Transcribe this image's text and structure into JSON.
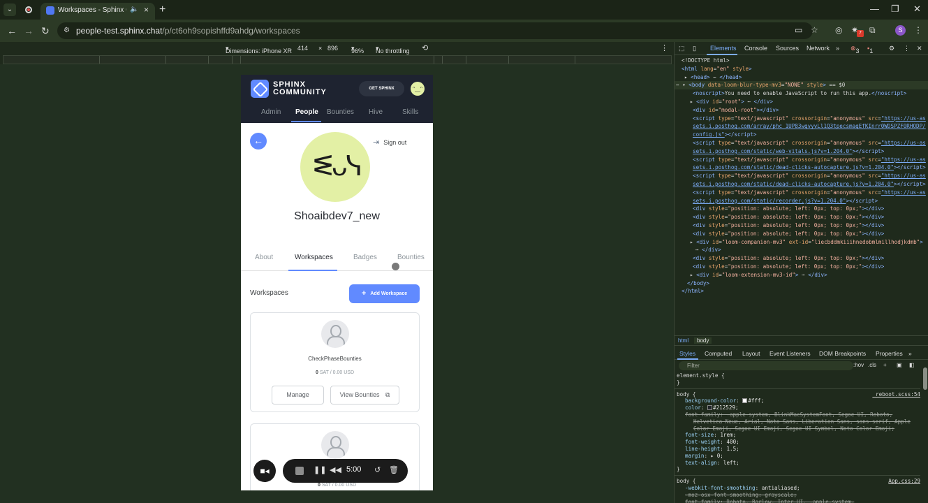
{
  "browser": {
    "tab_title": "Workspaces - Sphinx Comm",
    "url_host": "people-test.sphinx.chat",
    "url_path": "/p/ct6oh9sopishffd9ahdg/workspaces",
    "profile_initial": "S",
    "extension_badge": "7"
  },
  "device_toolbar": {
    "dimensions_label": "Dimensions: iPhone XR",
    "width": "414",
    "times": "×",
    "height": "896",
    "zoom": "96%",
    "throttle": "No throttling"
  },
  "app": {
    "logo_line1": "SPHINX",
    "logo_line2": "COMMUNITY",
    "get_sphinx": "GET SPHINX",
    "nav": [
      "Admin",
      "People",
      "Bounties",
      "Hive",
      "Skills"
    ],
    "sign_out": "Sign out",
    "username": "Shoaibdev7_new",
    "profile_tabs": [
      "About",
      "Workspaces",
      "Badges",
      "Bounties"
    ],
    "workspaces_heading": "Workspaces",
    "add_workspace": "Add Workspace",
    "workspace_card": {
      "name": "CheckPhaseBounties",
      "amount": "0",
      "amount_unit": "SAT",
      "usd": "0.00 USD",
      "manage": "Manage",
      "view_bounties": "View Bounties"
    },
    "card2_amount": "0",
    "card2_unit": "SAT",
    "card2_usd": "0.00 USD",
    "recorder_time": "5:00"
  },
  "devtools": {
    "tabs": [
      "Elements",
      "Console",
      "Sources",
      "Network"
    ],
    "errors": "3",
    "warnings": "1",
    "crumbs": [
      "html",
      "body"
    ],
    "styles_tabs": [
      "Styles",
      "Computed",
      "Layout",
      "Event Listeners",
      "DOM Breakpoints",
      "Properties"
    ],
    "filter_placeholder": "Filter",
    "hov": ":hov",
    "cls": ".cls"
  },
  "colors": {
    "accent": "#618aff",
    "app_header": "#1e2330",
    "avatar_bg": "#e3f0a5",
    "devtools_bg": "#1f2a1c"
  }
}
